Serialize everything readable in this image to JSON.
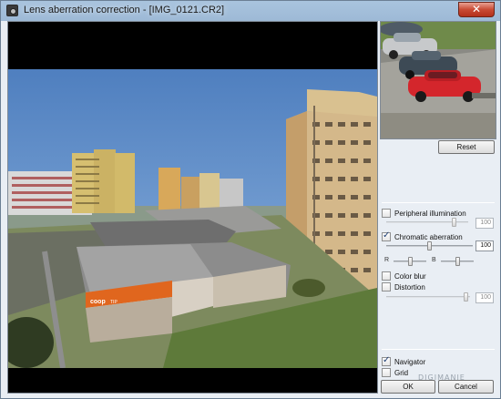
{
  "window": {
    "title": "Lens aberration correction - [IMG_0121.CR2]",
    "close_glyph": "✕"
  },
  "panel": {
    "reset_label": "Reset",
    "peripheral": {
      "label": "Peripheral illumination",
      "checked": false,
      "value": "100",
      "level": 0.85
    },
    "chromatic": {
      "label": "Chromatic aberration",
      "checked": true,
      "value": "100",
      "level": 0.5,
      "r_label": "R",
      "b_label": "B",
      "r_level": 0.5,
      "b_level": 0.5
    },
    "color_blur": {
      "label": "Color blur",
      "checked": false
    },
    "distortion": {
      "label": "Distortion",
      "checked": false,
      "value": "100",
      "level": 0.98
    },
    "navigator": {
      "label": "Navigator",
      "checked": true
    },
    "grid": {
      "label": "Grid",
      "checked": false
    },
    "ok_label": "OK",
    "cancel_label": "Cancel"
  },
  "photo": {
    "sign_text": "coop",
    "sign_suffix": "TIP"
  },
  "watermark": "DIGIMANIE"
}
